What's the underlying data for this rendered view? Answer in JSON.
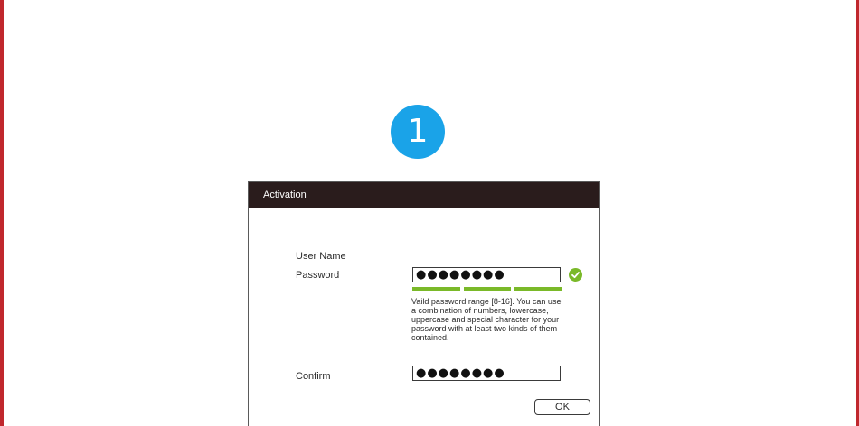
{
  "step": {
    "number": "1",
    "color": "#1aa3e8"
  },
  "colors": {
    "frame": "#c0272d",
    "header": "#2a1c1c",
    "strength": "#7ab929",
    "check": "#7ab929"
  },
  "dialog": {
    "title": "Activation",
    "username": {
      "label": "User Name"
    },
    "password": {
      "label": "Password",
      "masked_value": "●●●●●●●●",
      "valid_icon": "check-circle-icon",
      "strength_segments": 3,
      "hint": "Vaild password  range [8-16]. You can use a combination of numbers, lowercase, uppercase and special character for your password with at least two kinds of them contained."
    },
    "confirm": {
      "label": "Confirm",
      "masked_value": "●●●●●●●●"
    },
    "ok_label": "OK"
  }
}
